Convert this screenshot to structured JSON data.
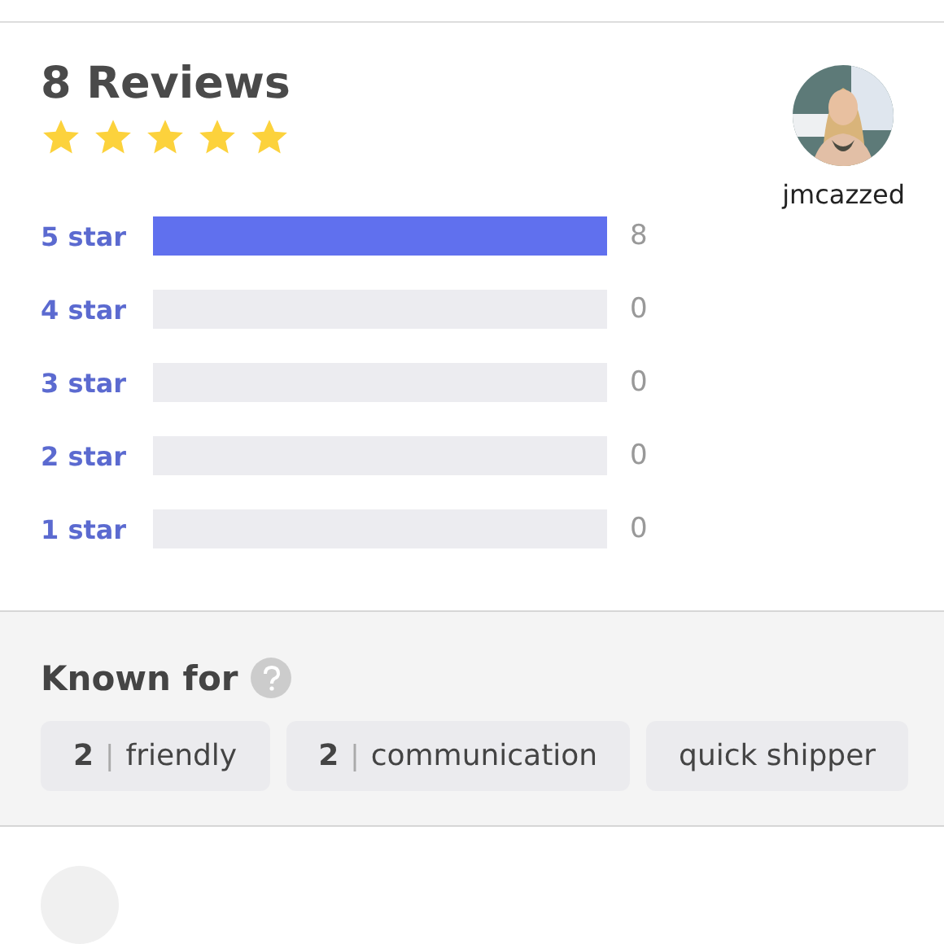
{
  "summary": {
    "title": "8 Reviews",
    "stars": 5
  },
  "user": {
    "username": "jmcazzed"
  },
  "breakdown": [
    {
      "label": "5 star",
      "level": 1,
      "count": "8"
    },
    {
      "label": "4 star",
      "count": "0"
    },
    {
      "label": "3 star",
      "count": "0"
    },
    {
      "label": "2 star",
      "count": "0"
    },
    {
      "label": "1 star",
      "count": "0"
    }
  ],
  "known_for": {
    "title": "Known for",
    "tags": [
      {
        "count": "2",
        "separator": "|",
        "label": "friendly"
      },
      {
        "count": "2",
        "separator": "|",
        "label": "communication"
      },
      {
        "label": "quick shipper"
      }
    ]
  }
}
